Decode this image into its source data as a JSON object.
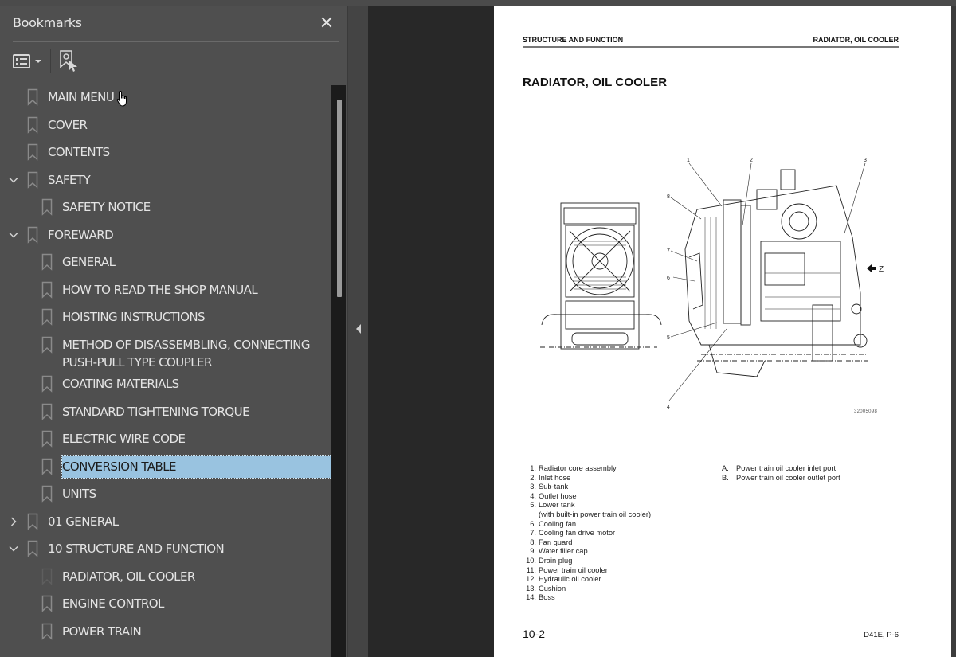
{
  "sidebar": {
    "title": "Bookmarks",
    "close_icon": "close-icon",
    "toolbar": {
      "options_icon": "list-options-icon",
      "find_bookmark_icon": "bookmark-find-icon"
    },
    "items": [
      {
        "label": "MAIN MENU",
        "level": 0,
        "expander": "none",
        "hovered": true
      },
      {
        "label": "COVER",
        "level": 0,
        "expander": "none"
      },
      {
        "label": "CONTENTS",
        "level": 0,
        "expander": "none"
      },
      {
        "label": "SAFETY",
        "level": 0,
        "expander": "expanded"
      },
      {
        "label": "SAFETY NOTICE",
        "level": 1,
        "expander": "none"
      },
      {
        "label": "FOREWARD",
        "level": 0,
        "expander": "expanded"
      },
      {
        "label": "GENERAL",
        "level": 1,
        "expander": "none"
      },
      {
        "label": "HOW TO READ THE SHOP MANUAL",
        "level": 1,
        "expander": "none"
      },
      {
        "label": "HOISTING INSTRUCTIONS",
        "level": 1,
        "expander": "none"
      },
      {
        "label": "METHOD OF DISASSEMBLING, CONNECTING PUSH-PULL TYPE COUPLER",
        "level": 1,
        "expander": "none"
      },
      {
        "label": "COATING MATERIALS",
        "level": 1,
        "expander": "none"
      },
      {
        "label": "STANDARD TIGHTENING TORQUE",
        "level": 1,
        "expander": "none"
      },
      {
        "label": "ELECTRIC WIRE CODE",
        "level": 1,
        "expander": "none"
      },
      {
        "label": "CONVERSION TABLE",
        "level": 1,
        "expander": "none",
        "selected": true
      },
      {
        "label": "UNITS",
        "level": 1,
        "expander": "none"
      },
      {
        "label": "01 GENERAL",
        "level": 0,
        "expander": "collapsed"
      },
      {
        "label": "10 STRUCTURE AND FUNCTION",
        "level": 0,
        "expander": "expanded"
      },
      {
        "label": "RADIATOR, OIL COOLER",
        "level": 1,
        "expander": "none",
        "current": true
      },
      {
        "label": "ENGINE CONTROL",
        "level": 1,
        "expander": "none"
      },
      {
        "label": "POWER TRAIN",
        "level": 1,
        "expander": "none"
      }
    ],
    "scroll_position_fraction": 0.0
  },
  "colors": {
    "panel_bg": "#4f4f4f",
    "viewer_bg": "#282828",
    "selection_bg": "#99c3e0",
    "text": "#e4e4e4"
  },
  "document": {
    "header_left": "STRUCTURE AND FUNCTION",
    "header_right": "RADIATOR, OIL COOLER",
    "title": "RADIATOR, OIL COOLER",
    "figure": {
      "callouts": [
        "1",
        "2",
        "3",
        "4",
        "5",
        "6",
        "7",
        "8"
      ],
      "view_marker": "Z",
      "drawing_code": "32005098"
    },
    "parts": [
      {
        "num": "1.",
        "text": "Radiator core assembly"
      },
      {
        "num": "2.",
        "text": "Inlet hose"
      },
      {
        "num": "3.",
        "text": "Sub-tank"
      },
      {
        "num": "4.",
        "text": "Outlet hose"
      },
      {
        "num": "5.",
        "text": "Lower tank"
      },
      {
        "num": "",
        "text": "(with built-in power train oil cooler)"
      },
      {
        "num": "6.",
        "text": "Cooling fan"
      },
      {
        "num": "7.",
        "text": "Cooling fan drive motor"
      },
      {
        "num": "8.",
        "text": "Fan guard"
      },
      {
        "num": "9.",
        "text": "Water filler cap"
      },
      {
        "num": "10.",
        "text": "Drain plug"
      },
      {
        "num": "11.",
        "text": "Power train oil cooler"
      },
      {
        "num": "12.",
        "text": "Hydraulic oil cooler"
      },
      {
        "num": "13.",
        "text": "Cushion"
      },
      {
        "num": "14.",
        "text": "Boss"
      }
    ],
    "ports": [
      {
        "num": "A.",
        "text": "Power train oil cooler inlet port"
      },
      {
        "num": "B.",
        "text": "Power train oil cooler outlet port"
      }
    ],
    "page_number": "10-2",
    "model_ref": "D41E, P-6"
  }
}
